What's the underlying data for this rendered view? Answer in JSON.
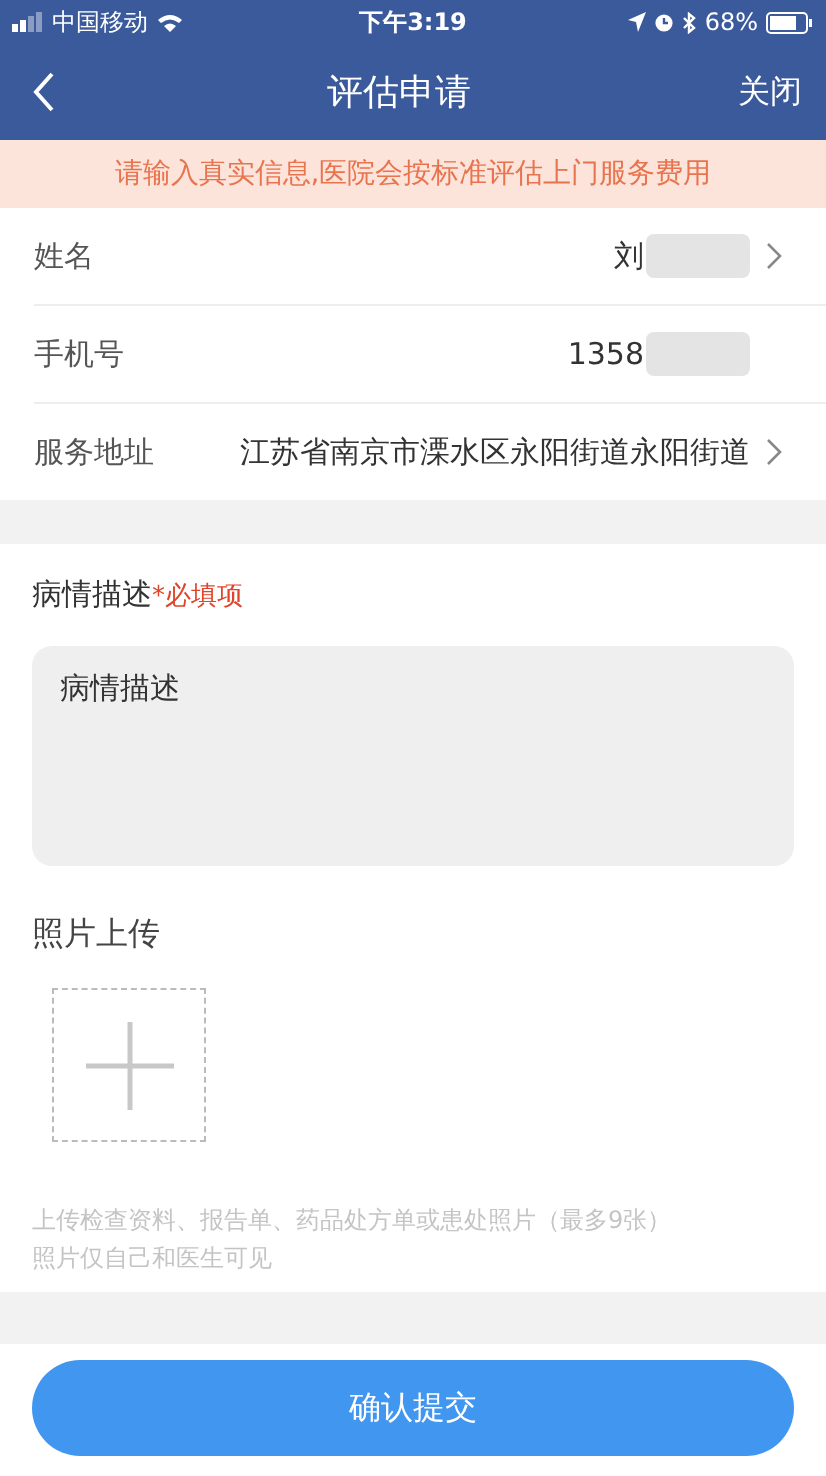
{
  "status_bar": {
    "carrier": "中国移动",
    "time": "下午3:19",
    "battery": "68%"
  },
  "nav": {
    "title": "评估申请",
    "close": "关闭"
  },
  "notice": "请输入真实信息,医院会按标准评估上门服务费用",
  "fields": [
    {
      "label": "姓名",
      "value": "刘",
      "redacted": true,
      "arrow": true
    },
    {
      "label": "手机号",
      "value": "1358",
      "redacted": true,
      "arrow": false
    },
    {
      "label": "服务地址",
      "value": "江苏省南京市溧水区永阳街道永阳街道",
      "redacted": false,
      "arrow": true
    }
  ],
  "description": {
    "label": "病情描述",
    "required": "*必填项",
    "value": "病情描述"
  },
  "photos": {
    "label": "照片上传",
    "hints": [
      "上传检查资料、报告单、药品处方单或患处照片（最多9张）",
      "照片仅自己和医生可见"
    ]
  },
  "submit": "确认提交"
}
